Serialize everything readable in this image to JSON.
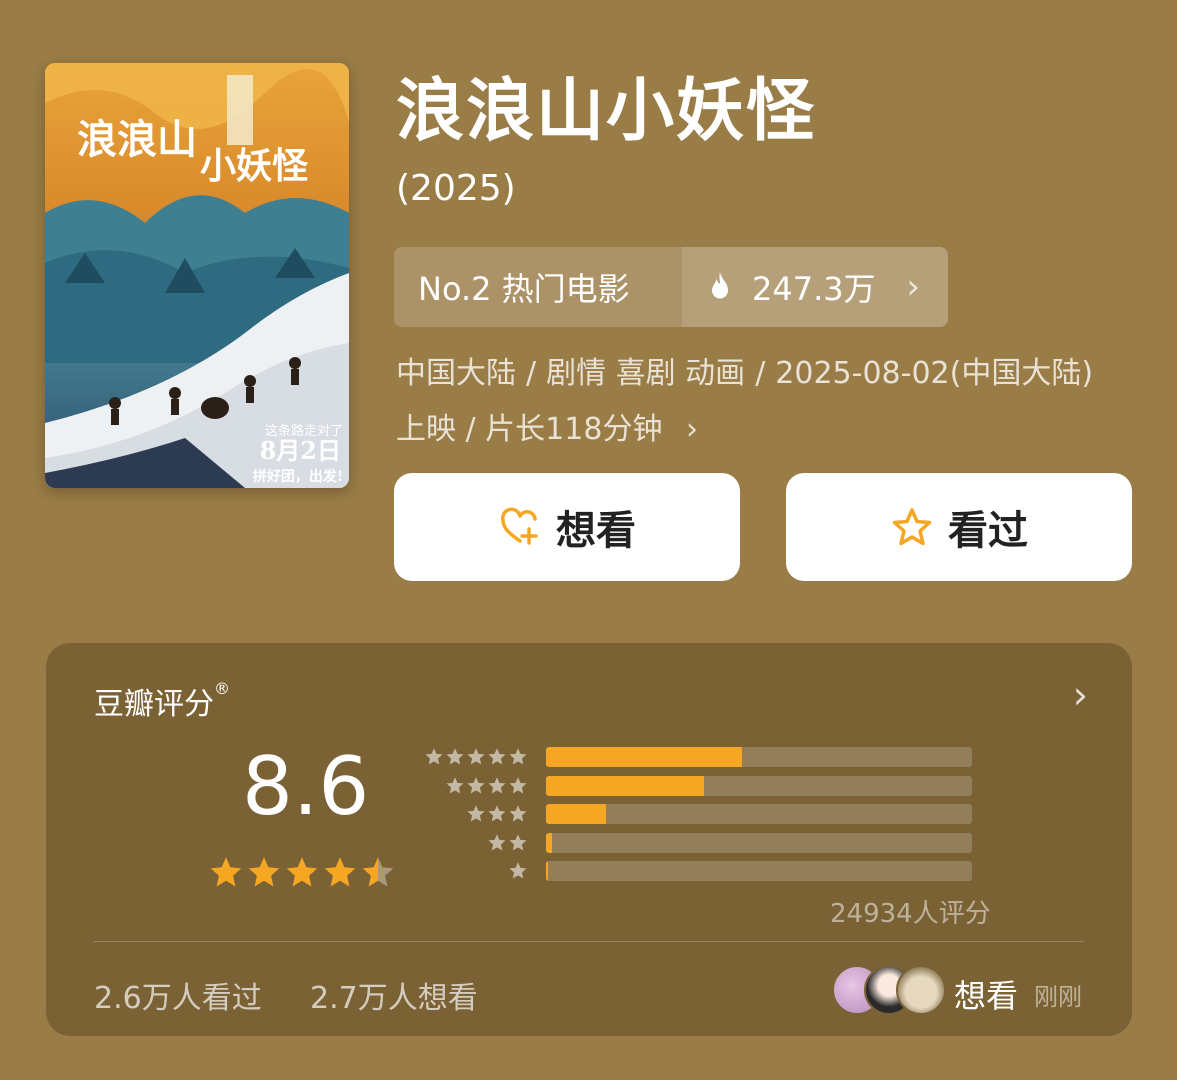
{
  "movie": {
    "title": "浪浪山小妖怪",
    "year": "(2025)",
    "rank_label": "No.2 热门电影",
    "heat": "247.3万",
    "meta_line1_parts": [
      "中国大陆",
      "/",
      "剧情 喜剧 动画",
      "/",
      "2025-08-02(中国大陆)"
    ],
    "meta_line2": "上映 / 片长118分钟",
    "poster_text": {
      "title": "浪浪山",
      "subtitle": "小妖怪",
      "slogan": "这条路走对了",
      "date": "8月2日",
      "tagline": "拼好团，出发!"
    }
  },
  "actions": {
    "want_label": "想看",
    "seen_label": "看过"
  },
  "rating": {
    "section_title": "豆瓣评分",
    "registered_mark": "®",
    "score": "8.6",
    "star_fill": 4.5,
    "distribution": [
      {
        "stars": 5,
        "fraction": 0.46
      },
      {
        "stars": 4,
        "fraction": 0.37
      },
      {
        "stars": 3,
        "fraction": 0.14
      },
      {
        "stars": 2,
        "fraction": 0.015
      },
      {
        "stars": 1,
        "fraction": 0.005
      }
    ],
    "count_text": "24934人评分",
    "seen_count": "2.6万人看过",
    "want_count": "2.7万人想看",
    "activity_label": "想看",
    "activity_time": "刚刚"
  },
  "colors": {
    "background": "#9a7c46",
    "accent": "#f5a623",
    "button_bg": "#ffffff"
  },
  "icons": {
    "fire": "fire-icon",
    "heart_plus": "heart-plus-icon",
    "star": "star-icon",
    "chevron": "chevron-right-icon"
  }
}
